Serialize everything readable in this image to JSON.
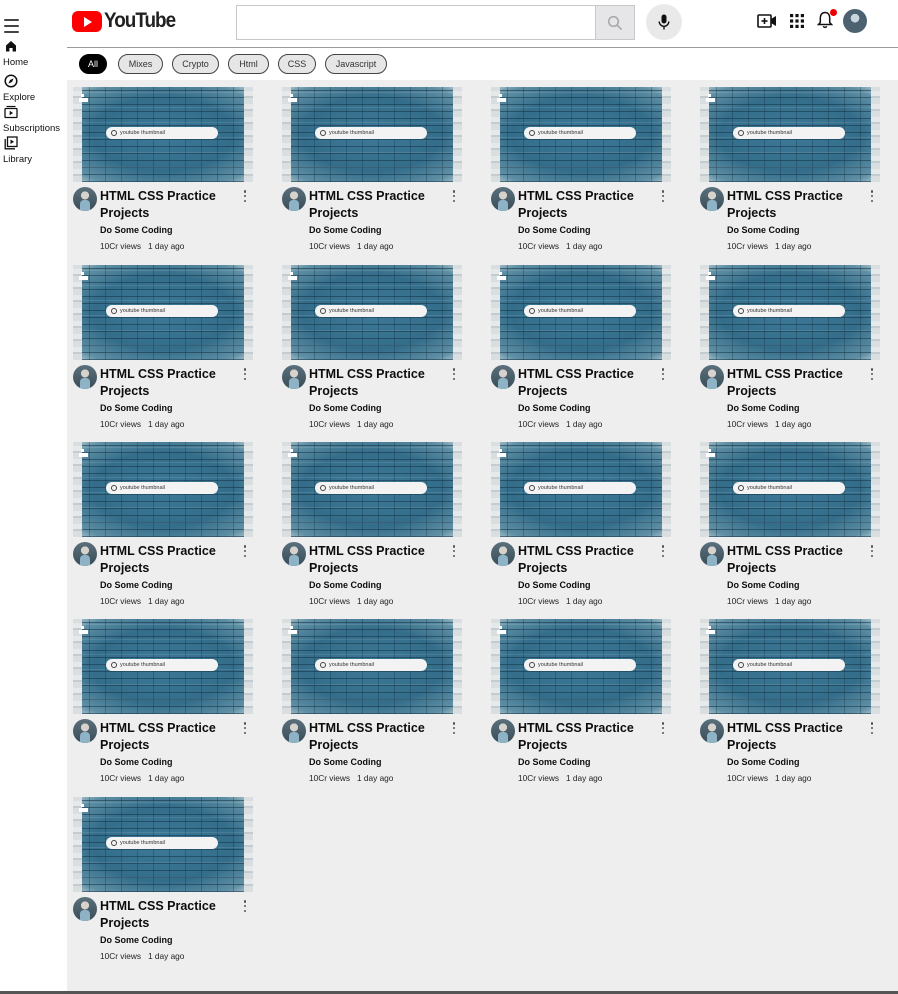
{
  "header": {
    "logo_text": "YouTube",
    "search_value": "",
    "icons": [
      "menu-icon",
      "search-icon",
      "mic-icon",
      "video-create-icon",
      "apps-grid-icon",
      "bell-icon",
      "avatar"
    ],
    "notification_color": "#e00000",
    "brand_color": "#ff0000"
  },
  "sidebar": {
    "items": [
      {
        "label": "Home",
        "icon": "home-icon"
      },
      {
        "label": "Explore",
        "icon": "compass-icon"
      },
      {
        "label": "Subscriptions",
        "icon": "subscriptions-icon"
      },
      {
        "label": "Library",
        "icon": "library-icon"
      }
    ]
  },
  "chips": [
    "All",
    "Mixes",
    "Crypto",
    "Html",
    "CSS",
    "Javascript"
  ],
  "active_chip": "All",
  "video": {
    "title": "HTML CSS Practice Projects",
    "channel": "Do Some Coding",
    "views": "10Cr views",
    "age": "1 day ago",
    "thumb_search_text": "youtube thumbnail"
  },
  "video_count": 17
}
